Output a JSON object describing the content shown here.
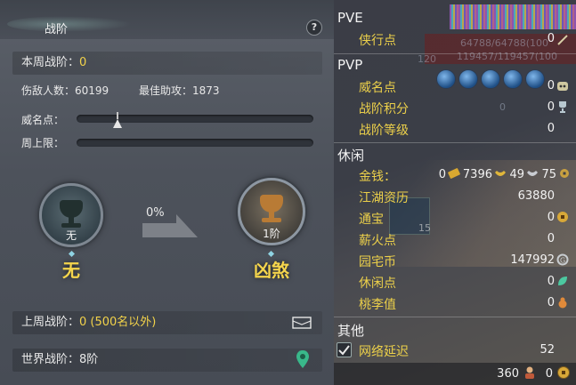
{
  "left_panel": {
    "title": "战阶",
    "help_label": "?",
    "weekly_rank": {
      "label": "本周战阶：",
      "value": "0"
    },
    "stats": {
      "wounded_label": "伤敌人数：",
      "wounded_value": "60199",
      "best_assist_label": "最佳助攻：",
      "best_assist_value": "1873"
    },
    "prestige_label": "威名点：",
    "weekly_cap_label": "周上限：",
    "current_medal": {
      "rank": "无",
      "name": "无"
    },
    "progress_percent": "0%",
    "next_medal": {
      "rank": "1阶",
      "name": "凶煞"
    },
    "last_week": {
      "label": "上周战阶：",
      "value": "0 (500名以外)"
    },
    "world": {
      "label": "世界战阶：",
      "value": "8阶"
    }
  },
  "right_panel": {
    "sections": {
      "pve": "PVE",
      "pvp": "PVP",
      "leisure": "休闲",
      "other": "其他"
    },
    "pve_rows": [
      {
        "label": "侠行点",
        "value": "0"
      }
    ],
    "pvp_rows": [
      {
        "label": "威名点",
        "value": "0"
      },
      {
        "label": "战阶积分",
        "value": "0"
      },
      {
        "label": "战阶等级",
        "value": "0"
      }
    ],
    "money": {
      "label": "金钱：",
      "gold": "0",
      "ingots": "7396",
      "silver": "49",
      "copper": "75"
    },
    "leisure_rows": [
      {
        "label": "江湖资历",
        "value": "63880"
      },
      {
        "label": "通宝",
        "value": "0"
      },
      {
        "label": "薪火点",
        "value": "0"
      },
      {
        "label": "园宅币",
        "value": "147992"
      },
      {
        "label": "休闲点",
        "value": "0"
      },
      {
        "label": "桃李值",
        "value": "0"
      }
    ],
    "other_rows": [
      {
        "label": "网络延迟",
        "value": "52",
        "checked": true
      }
    ],
    "footer": {
      "count_a": "360",
      "count_b": "0"
    },
    "background_text": {
      "hp": "64788/64788(100",
      "mp": "119457/119457(100",
      "level": "120",
      "zero": "0",
      "num": "15"
    }
  },
  "colors": {
    "accent_yellow": "#f3d34a",
    "panel_left": "#50555e",
    "panel_right": "#3b3e47"
  }
}
